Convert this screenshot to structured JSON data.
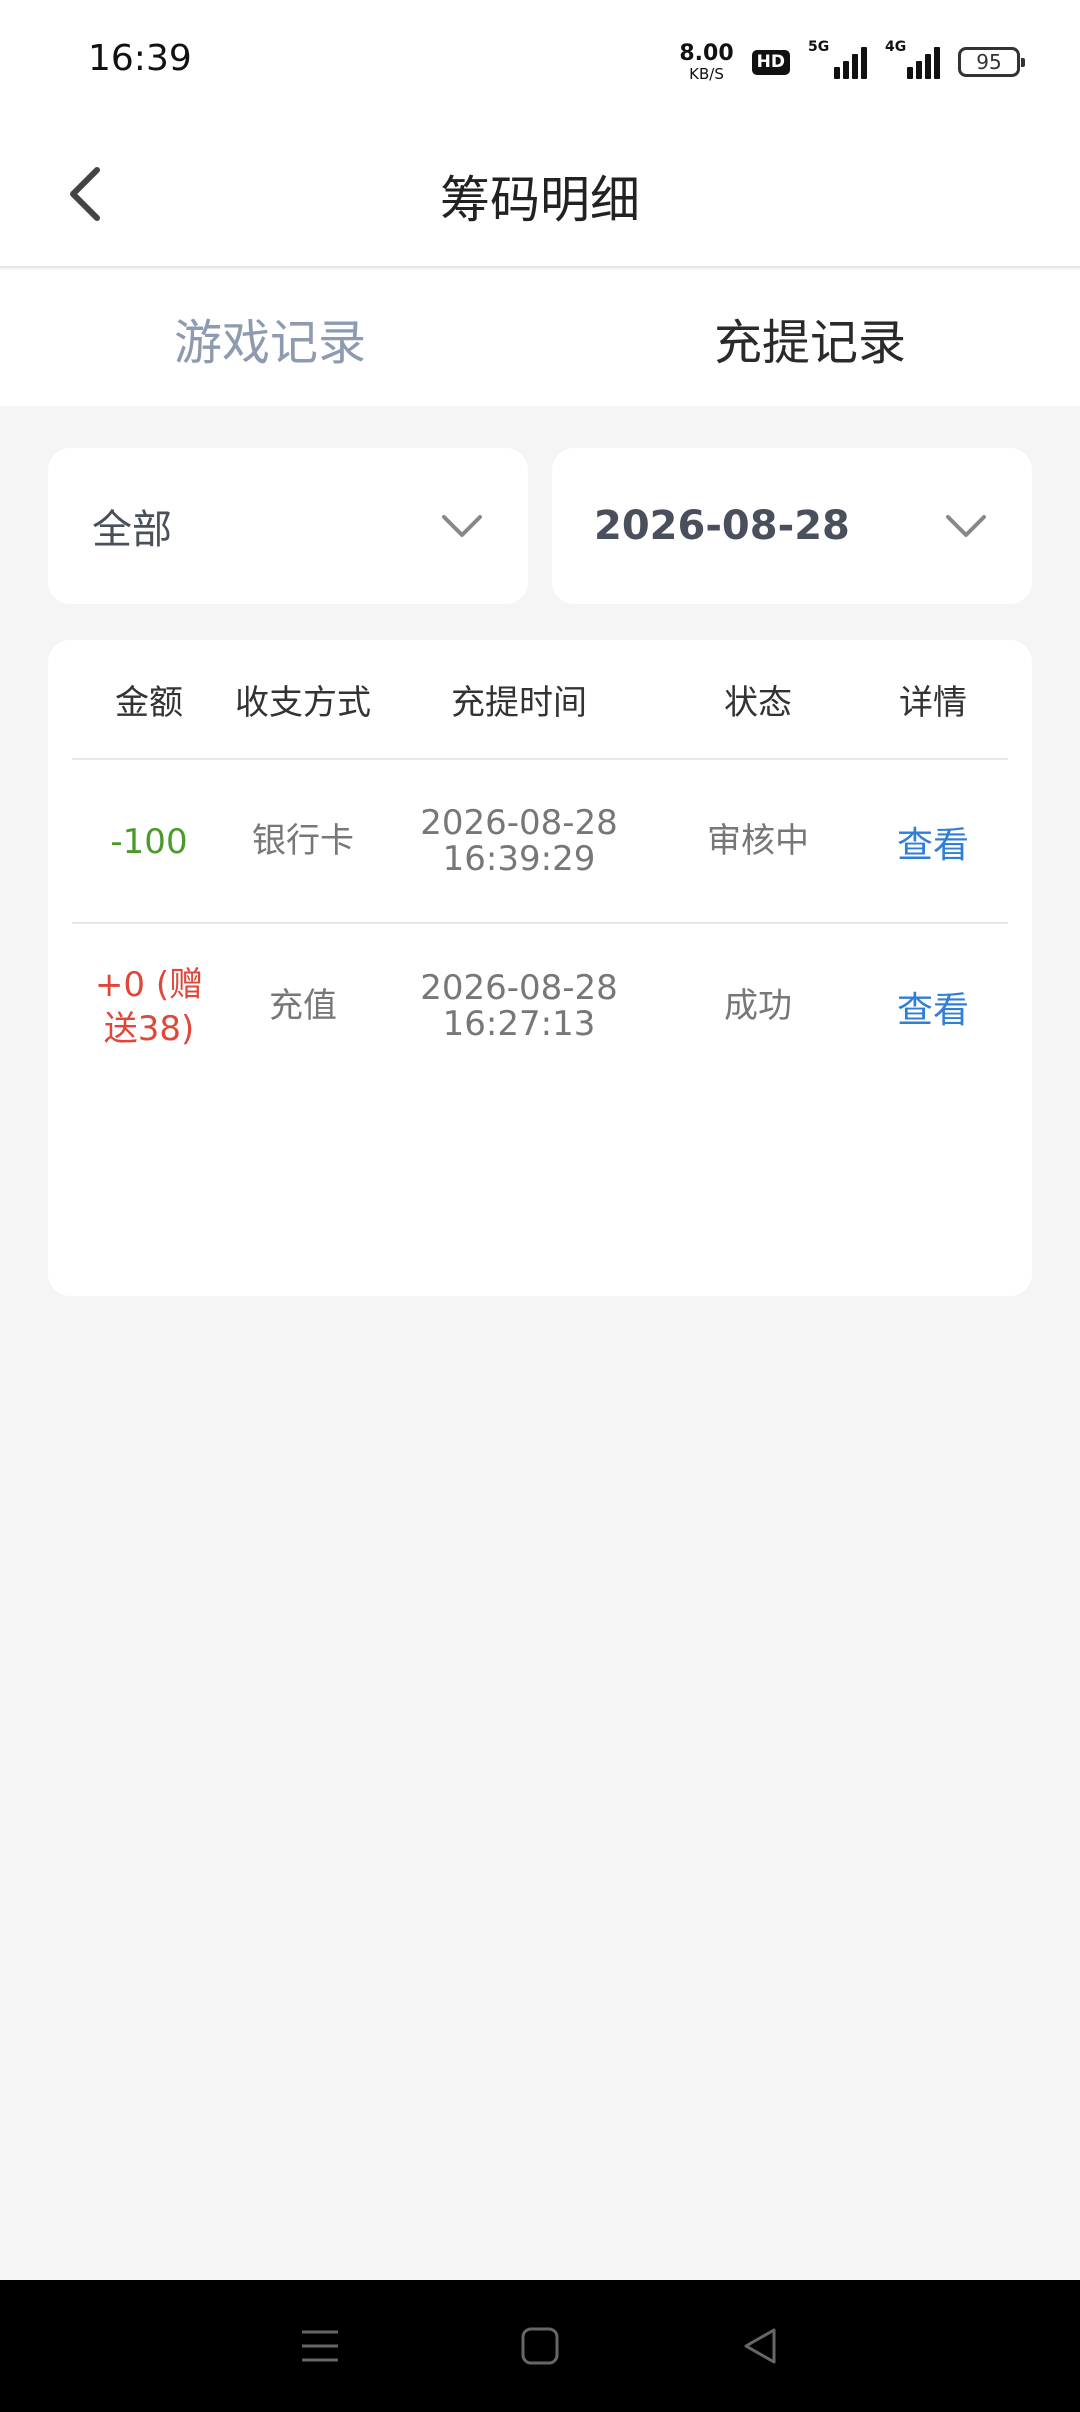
{
  "status_bar": {
    "time": "16:39",
    "net_speed_value": "8.00",
    "net_speed_unit": "KB/S",
    "hd_label": "HD",
    "signal_1_label": "5G",
    "signal_2_label": "4G",
    "battery": "95"
  },
  "header": {
    "title": "筹码明细"
  },
  "tabs": [
    {
      "label": "游戏记录",
      "active": false
    },
    {
      "label": "充提记录",
      "active": true
    }
  ],
  "filters": {
    "type_value": "全部",
    "date_value": "2026-08-28"
  },
  "table": {
    "columns": [
      "金额",
      "收支方式",
      "充提时间",
      "状态",
      "详情"
    ],
    "rows": [
      {
        "amount": "-100",
        "method": "银行卡",
        "date": "2026-08-28",
        "time": "16:39:29",
        "status": "审核中",
        "detail": "查看"
      },
      {
        "amount_line1": "+0 (赠",
        "amount_line2": "送38)",
        "method": "充值",
        "date": "2026-08-28",
        "time": "16:27:13",
        "status": "成功",
        "detail": "查看"
      }
    ]
  },
  "colors": {
    "negative_amount": "#4a9a2c",
    "positive_amount": "#e0473a",
    "link": "#2f7fd6",
    "inactive_tab": "#8e9ab0"
  }
}
